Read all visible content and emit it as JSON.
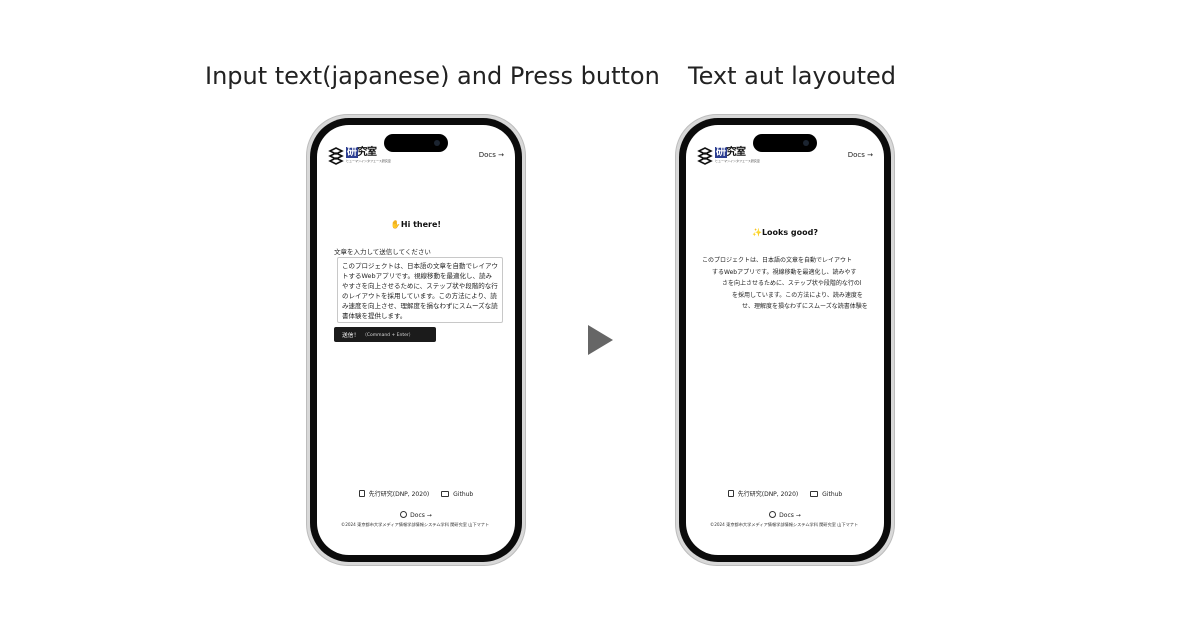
{
  "captions": {
    "left": "Input text(japanese) and Press button",
    "right": "Text aut layouted"
  },
  "header": {
    "logo_title_first": "研",
    "logo_title_rest": "究室",
    "logo_subtitle": "ヒューマンインタフェース研究室",
    "docs_link": "Docs →"
  },
  "left_screen": {
    "heading": "✋Hi there!",
    "prompt_label": "文章を入力して送信してください",
    "textarea_value": "このプロジェクトは、日本語の文章を自動でレイアウトするWebアプリです。視線移動を最適化し、読みやすさを向上させるために、ステップ状や段階的な行のレイアウトを採用しています。この方法により、読み速度を向上させ、理解度を損なわずにスムーズな読書体験を提供します。",
    "submit_label": "送信！",
    "submit_hint": "（Command + Enter）"
  },
  "right_screen": {
    "heading": "✨Looks good?",
    "output_lines": [
      "このプロジェクトは、日本語の文章を自動でレイアウト",
      "するWebアプリです。視線移動を最適化し、読みやす",
      "さを向上させるために、ステップ状や段階的な行のl",
      "を採用しています。この方法により、読み速度を",
      "せ、理解度を損なわずにスムーズな読書体験を"
    ]
  },
  "footer": {
    "prior_research": "先行研究(DNP, 2020)",
    "github": "Github",
    "docs": "Docs →",
    "copyright": "©2024 東京都市大学メディア情報学部情報システム学科 関研究室 山下マナト"
  },
  "colors": {
    "logo_blue": "#2c3e91",
    "button_bg": "#1b1b1b",
    "arrow": "#666666"
  }
}
